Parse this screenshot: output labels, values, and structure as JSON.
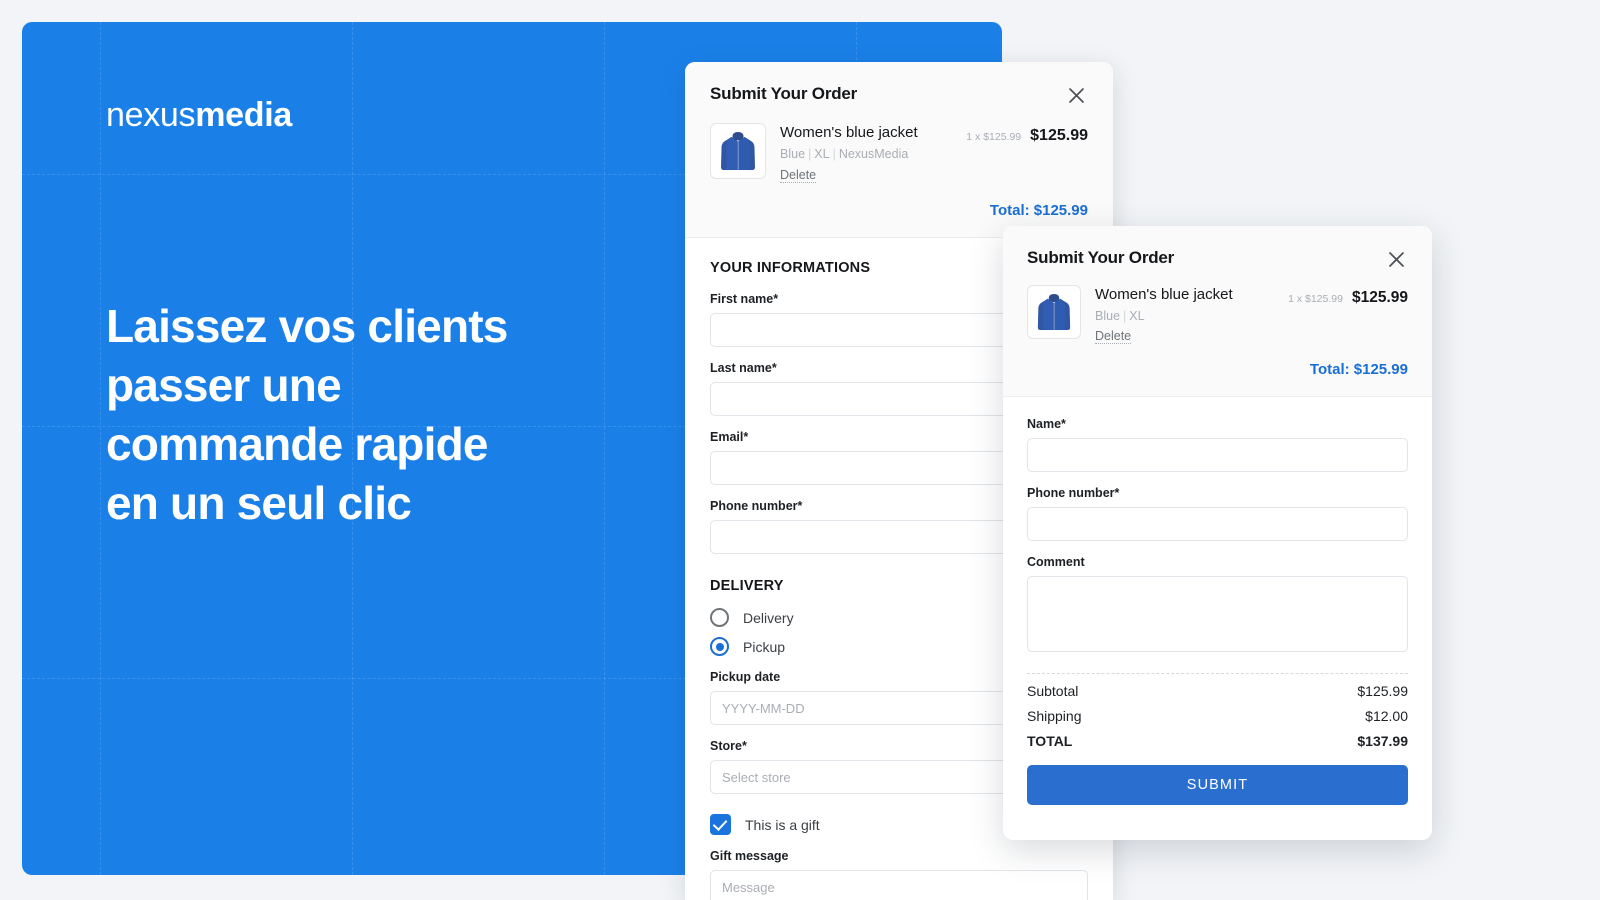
{
  "theme": {
    "brand_blue": "#1a80e8",
    "accent_blue": "#1a6fd4",
    "submit_blue": "#2a6fd0",
    "page_bg": "#f2f4f7"
  },
  "hero": {
    "logo_light": "nexus",
    "logo_bold": "media",
    "headline": "Laissez vos clients passer une commande rapide en un seul clic"
  },
  "back_modal": {
    "title": "Submit Your Order",
    "close_icon": "close-icon",
    "item": {
      "thumb_icon": "product-thumbnail-blue-jacket",
      "name": "Women's blue jacket",
      "meta_color": "Blue",
      "meta_size": "XL",
      "meta_brand": "NexusMedia",
      "delete_label": "Delete",
      "unit_price": "1 x $125.99",
      "line_price": "$125.99"
    },
    "total_label": "Total: $125.99",
    "informations": {
      "section_title": "YOUR INFORMATIONS",
      "fields": [
        {
          "label": "First name*",
          "value": "",
          "placeholder": ""
        },
        {
          "label": "Last name*",
          "value": "",
          "placeholder": ""
        },
        {
          "label": "Email*",
          "value": "",
          "placeholder": ""
        },
        {
          "label": "Phone number*",
          "value": "",
          "placeholder": ""
        }
      ]
    },
    "delivery": {
      "section_title": "DELIVERY",
      "options": [
        {
          "label": "Delivery",
          "selected": false
        },
        {
          "label": "Pickup",
          "selected": true
        }
      ],
      "pickup_date_label": "Pickup date",
      "pickup_date_placeholder": "YYYY-MM-DD",
      "pickup_date_value": "",
      "store_label": "Store*",
      "store_placeholder": "Select store",
      "store_value": "",
      "gift_checkbox_label": "This is a gift",
      "gift_checked": true,
      "gift_message_label": "Gift message",
      "gift_message_placeholder": "Message",
      "gift_message_value": ""
    }
  },
  "front_modal": {
    "title": "Submit Your Order",
    "close_icon": "close-icon",
    "item": {
      "thumb_icon": "product-thumbnail-blue-jacket",
      "name": "Women's blue jacket",
      "meta_color": "Blue",
      "meta_size": "XL",
      "delete_label": "Delete",
      "unit_price": "1 x $125.99",
      "line_price": "$125.99"
    },
    "total_label": "Total: $125.99",
    "fields": {
      "name_label": "Name*",
      "name_value": "",
      "phone_label": "Phone number*",
      "phone_value": "",
      "comment_label": "Comment",
      "comment_value": ""
    },
    "totals": [
      {
        "label": "Subtotal",
        "value": "$125.99"
      },
      {
        "label": "Shipping",
        "value": "$12.00"
      },
      {
        "label": "TOTAL",
        "value": "$137.99"
      }
    ],
    "submit_label": "SUBMIT"
  }
}
